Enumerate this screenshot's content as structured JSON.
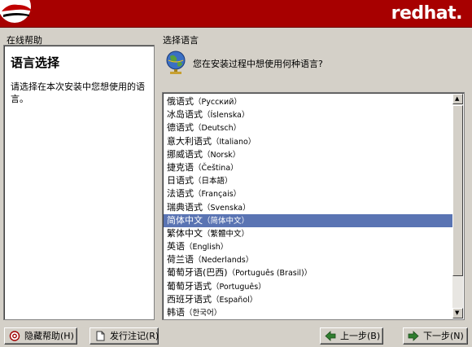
{
  "banner": {
    "brand": "redhat."
  },
  "help": {
    "section_title": "在线帮助",
    "heading": "语言选择",
    "text": "请选择在本次安装中您想使用的语言。"
  },
  "language": {
    "section_title": "选择语言",
    "question": "您在安装过程中想使用何种语言?",
    "items": [
      {
        "zh": "俄语式",
        "native": "（Русский）"
      },
      {
        "zh": "冰岛语式",
        "native": "（Íslenska）"
      },
      {
        "zh": "德语式",
        "native": "（Deutsch）"
      },
      {
        "zh": "意大利语式",
        "native": "（Italiano）"
      },
      {
        "zh": "挪威语式",
        "native": "（Norsk）"
      },
      {
        "zh": "捷克语",
        "native": "（Čeština）"
      },
      {
        "zh": "日语式",
        "native": "（日本語）"
      },
      {
        "zh": "法语式",
        "native": "（Français）"
      },
      {
        "zh": "瑞典语式",
        "native": "（Svenska）"
      },
      {
        "zh": "简体中文",
        "native": "（简体中文）"
      },
      {
        "zh": "繁体中文",
        "native": "（繁體中文）"
      },
      {
        "zh": "英语",
        "native": "（English）"
      },
      {
        "zh": "荷兰语",
        "native": "（Nederlands）"
      },
      {
        "zh": "葡萄牙语(巴西)",
        "native": "（Português (Brasil)）"
      },
      {
        "zh": "葡萄牙语式",
        "native": "（Português）"
      },
      {
        "zh": "西班牙语式",
        "native": "（Español）"
      },
      {
        "zh": "韩语",
        "native": "（한국어）"
      }
    ],
    "selected_index": 9
  },
  "buttons": {
    "hide_help": "隐藏帮助(H)",
    "release_notes": "发行注记(R)",
    "back": "上一步(B)",
    "next": "下一步(N)"
  },
  "colors": {
    "banner_red": "#a70000",
    "selection_blue": "#5a74b3",
    "window_gray": "#d4d0c8"
  }
}
